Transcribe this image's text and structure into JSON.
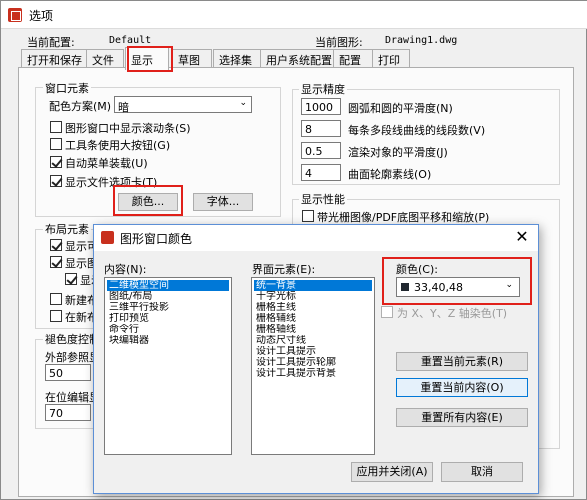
{
  "window": {
    "title": "选项",
    "current_config_label": "当前配置:",
    "current_config_value": "Default",
    "current_drawing_label": "当前图形:",
    "current_drawing_value": "Drawing1.dwg"
  },
  "tabs": [
    "打开和保存",
    "文件",
    "显示",
    "草图",
    "选择集",
    "用户系统配置",
    "配置",
    "打印"
  ],
  "active_tab": "显示",
  "window_elements": {
    "title": "窗口元素",
    "color_scheme_label": "配色方案(M)",
    "color_scheme_value": "暗",
    "checkboxes": [
      {
        "label": "图形窗口中显示滚动条(S)",
        "checked": false
      },
      {
        "label": "工具条使用大按钮(G)",
        "checked": false
      },
      {
        "label": "自动菜单装载(U)",
        "checked": true
      },
      {
        "label": "显示文件选项卡(T)",
        "checked": true
      }
    ],
    "color_button": "颜色...",
    "font_button": "字体..."
  },
  "layout_elements": {
    "title": "布局元素",
    "checkboxes": [
      {
        "label": "显示可",
        "checked": true
      },
      {
        "label": "显示图",
        "checked": true
      },
      {
        "label": "显示",
        "checked": true
      },
      {
        "label": "新建布",
        "checked": false
      },
      {
        "label": "在新布",
        "checked": false
      }
    ]
  },
  "fade_control": {
    "title": "褪色度控制",
    "xref_label": "外部参照显",
    "xref_value": "50",
    "inplace_label": "在位编辑显",
    "inplace_value": "70"
  },
  "display_precision": {
    "title": "显示精度",
    "rows": [
      {
        "value": "1000",
        "label": "圆弧和圆的平滑度(N)"
      },
      {
        "value": "8",
        "label": "每条多段线曲线的线段数(V)"
      },
      {
        "value": "0.5",
        "label": "渲染对象的平滑度(J)"
      },
      {
        "value": "4",
        "label": "曲面轮廓素线(O)"
      }
    ]
  },
  "display_performance": {
    "title": "显示性能",
    "first_checkbox": "带光栅图像/PDF底图平移和缩放(P)"
  },
  "dialog": {
    "title": "图形窗口颜色",
    "context_label": "内容(N):",
    "context_items": [
      "二维模型空间",
      "图纸/布局",
      "三维平行投影",
      "打印预览",
      "命令行",
      "块编辑器"
    ],
    "context_selected": 0,
    "interface_label": "界面元素(E):",
    "interface_items": [
      "统一背景",
      "十字光标",
      "栅格主线",
      "栅格辅线",
      "栅格轴线",
      "动态尺寸线",
      "设计工具提示",
      "设计工具提示轮廓",
      "设计工具提示背景"
    ],
    "interface_selected": 0,
    "color_label": "颜色(C):",
    "color_value": "33,40,48",
    "color_swatch": "#212830",
    "tint_checkbox": "为 X、Y、Z 轴染色(T)",
    "reset_element": "重置当前元素(R)",
    "reset_context": "重置当前内容(O)",
    "reset_all": "重置所有内容(E)",
    "apply_close": "应用并关闭(A)",
    "cancel": "取消"
  }
}
